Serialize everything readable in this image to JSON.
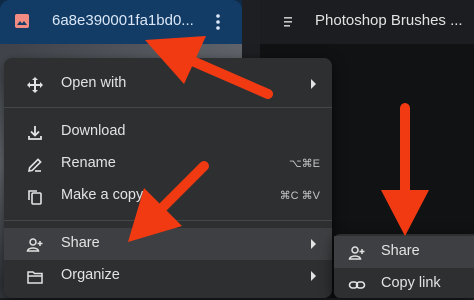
{
  "file_tile": {
    "title": "6a8e390001fa1bd0...",
    "icon": "image-icon",
    "menu_icon": "more-vert-icon"
  },
  "second_tile": {
    "title": "Photoshop Brushes ...",
    "icon": "doc-icon"
  },
  "context_menu": {
    "items": [
      {
        "label": "Open with",
        "icon": "open-with-icon",
        "shortcut": "",
        "submenu": true
      },
      {
        "label": "Download",
        "icon": "download-icon",
        "shortcut": "",
        "submenu": false
      },
      {
        "label": "Rename",
        "icon": "rename-icon",
        "shortcut": "⌥⌘E",
        "submenu": false
      },
      {
        "label": "Make a copy",
        "icon": "copy-icon",
        "shortcut": "⌘C ⌘V",
        "submenu": false
      },
      {
        "label": "Share",
        "icon": "share-person-add-icon",
        "shortcut": "",
        "submenu": true
      },
      {
        "label": "Organize",
        "icon": "folder-icon",
        "shortcut": "",
        "submenu": true
      }
    ]
  },
  "share_submenu": {
    "items": [
      {
        "label": "Share",
        "icon": "share-person-add-icon"
      },
      {
        "label": "Copy link",
        "icon": "link-icon"
      }
    ]
  },
  "colors": {
    "header_selected": "#123c66",
    "menu_bg": "#2d2f31",
    "annotation_arrow": "#f23a12"
  }
}
